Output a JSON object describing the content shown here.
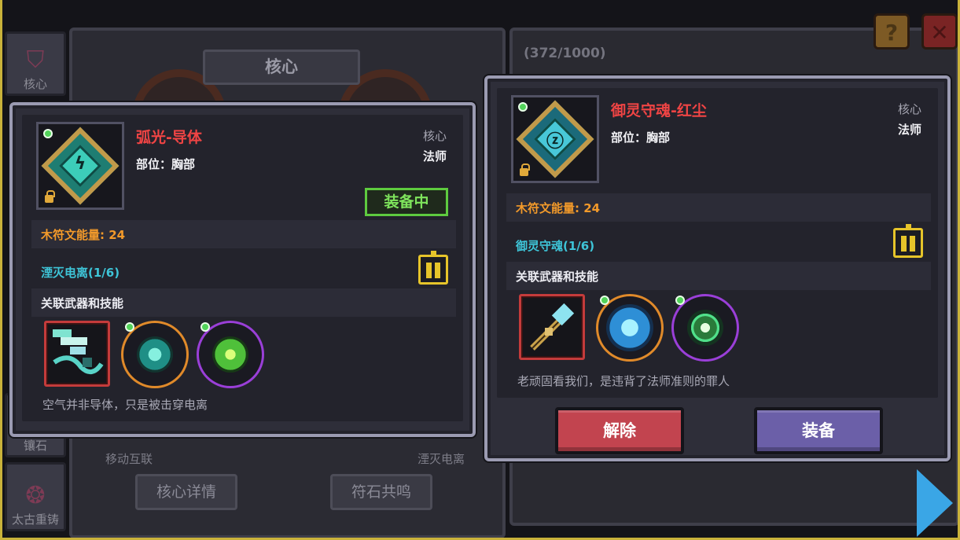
{
  "background": {
    "sidebar": [
      {
        "label": "核心",
        "icon": "core-tab-icon"
      },
      {
        "label": "镶石",
        "icon": "inlay-tab-icon"
      },
      {
        "label": "太古重铸",
        "icon": "reforge-tab-icon"
      }
    ],
    "core_title": "核心",
    "slot_labels": [
      "移动互联",
      "湮灭电离"
    ],
    "buttons": [
      "核心详情",
      "符石共鸣"
    ],
    "progress": "(372/1000)",
    "help_label": "?",
    "close_label": "✕"
  },
  "left_card": {
    "name": "弧光-导体",
    "slot": "部位：胸部",
    "type_a": "核心",
    "type_b": "法师",
    "equipped_badge": "装备中",
    "energy": "木符文能量: 24",
    "set_name": "湮灭电离(1/6)",
    "related_title": "关联武器和技能",
    "quote": "空气并非导体，只是被击穿电离"
  },
  "right_card": {
    "name": "御灵守魂-红尘",
    "slot": "部位：胸部",
    "type_a": "核心",
    "type_b": "法师",
    "energy": "木符文能量: 24",
    "set_name": "御灵守魂(1/6)",
    "related_title": "关联武器和技能",
    "quote": "老顽固看我们，是违背了法师准则的罪人",
    "unequip_label": "解除",
    "equip_label": "装备"
  },
  "colors": {
    "item_name": "#f04444",
    "energy": "#f39a2a",
    "set_name": "#3ec5d8",
    "equipped": "#7ee35c",
    "unequip_button": "#c2444f",
    "equip_button": "#6b5fa8",
    "frame": "#c9b23a"
  }
}
